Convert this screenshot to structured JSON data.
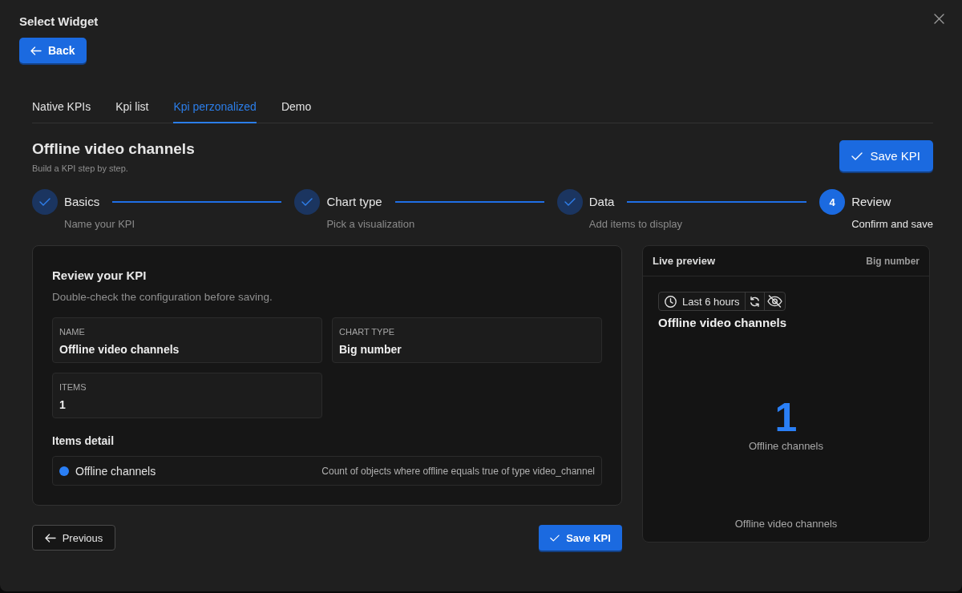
{
  "dialog": {
    "title": "Select Widget",
    "back_button": "Back"
  },
  "tabs": [
    {
      "label": "Native KPIs",
      "selected": false
    },
    {
      "label": "Kpi list",
      "selected": false
    },
    {
      "label": "Kpi perzonalized",
      "selected": true
    },
    {
      "label": "Demo",
      "selected": false
    }
  ],
  "header": {
    "title": "Offline video channels",
    "subtitle": "Build a KPI step by step.",
    "save_button": "Save KPI"
  },
  "steps": [
    {
      "title": "Basics",
      "description": "Name your KPI",
      "completed": true,
      "current": false
    },
    {
      "title": "Chart type",
      "description": "Pick a visualization",
      "completed": true,
      "current": false
    },
    {
      "title": "Data",
      "description": "Add items to display",
      "completed": true,
      "current": false
    },
    {
      "title": "Review",
      "description": "Confirm and save",
      "number": "4",
      "completed": false,
      "current": true
    }
  ],
  "review": {
    "title": "Review your KPI",
    "description": "Double-check the configuration before saving.",
    "fields": [
      {
        "label": "NAME",
        "value": "Offline video channels"
      },
      {
        "label": "CHART TYPE",
        "value": "Big number"
      },
      {
        "label": "ITEMS",
        "value": "1"
      }
    ],
    "items_title": "Items detail",
    "items": [
      {
        "name": "Offline channels",
        "description": "Count of objects where offline equals true of type video_channel",
        "color": "#2a7ff6"
      }
    ]
  },
  "footer": {
    "previous_button": "Previous",
    "save_button": "Save KPI"
  },
  "preview": {
    "title": "Live preview",
    "chart_type": "Big number",
    "time_range": "Last 6 hours",
    "widget_title": "Offline video channels",
    "value": "1",
    "value_label": "Offline channels",
    "caption": "Offline video channels"
  }
}
